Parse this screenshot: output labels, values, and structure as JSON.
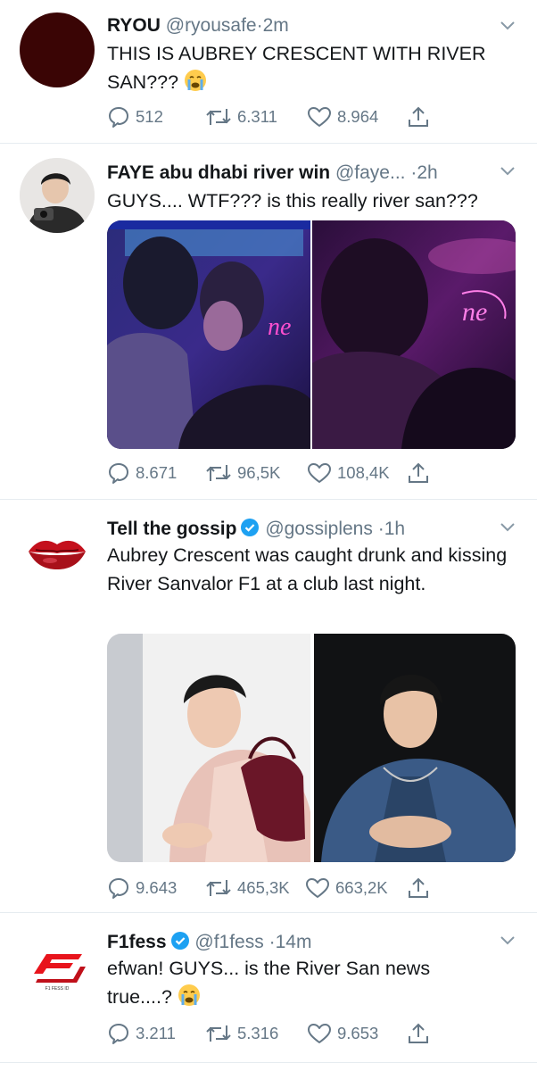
{
  "tweets": [
    {
      "name": "RYOU",
      "handle": "@ryousafe",
      "dot": "·",
      "time": "2m",
      "text": "THIS IS AUBREY CRESCENT WITH RIVER SAN???",
      "emoji": "crying-face",
      "replies": "512",
      "retweets": "6.311",
      "likes": "8.964",
      "verified": false
    },
    {
      "name": "FAYE abu dhabi river win",
      "handle": "@faye...",
      "dot": "·",
      "time": "2h",
      "text": "GUYS.... WTF??? is this really river san???",
      "replies": "8.671",
      "retweets": "96,5K",
      "likes": "108,4K",
      "verified": false,
      "media_neon_left": "ne",
      "media_neon_right": "ne"
    },
    {
      "name": "Tell the gossip",
      "handle": "@gossiplens",
      "dot": "·",
      "time": "1h",
      "text": "Aubrey Crescent was caught drunk and kissing River Sanvalor F1 at a club last night.",
      "replies": "9.643",
      "retweets": "465,3K",
      "likes": "663,2K",
      "verified": true
    },
    {
      "name": "F1fess",
      "handle": "@f1fess",
      "dot": "·",
      "time": "14m",
      "text": "efwan! GUYS... is the River San news true....?",
      "emoji": "crying-face",
      "replies": "3.211",
      "retweets": "5.316",
      "likes": "9.653",
      "verified": true,
      "logo_caption": "F1 FESS ID"
    }
  ],
  "colors": {
    "text": "#14171a",
    "secondary": "#657786",
    "verified": "#1da1f2",
    "divider": "#e6ecf0"
  }
}
